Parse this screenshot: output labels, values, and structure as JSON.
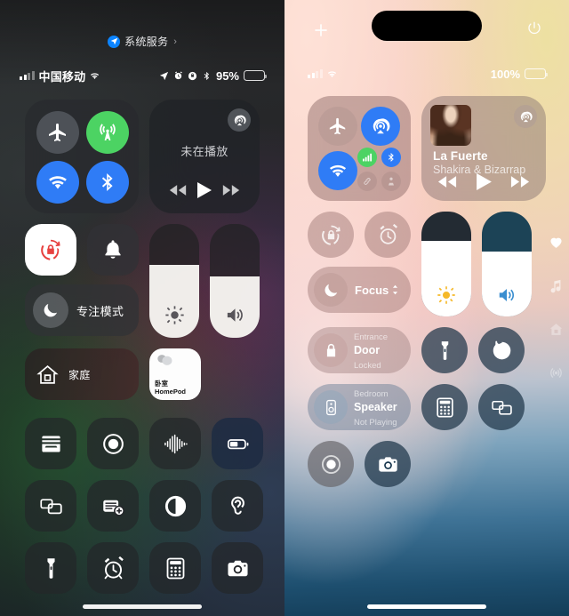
{
  "left_panel": {
    "system_services": {
      "label": "系统服务",
      "chevron": "›",
      "icon": "location-arrow-icon"
    },
    "status_bar": {
      "carrier": "中国移动",
      "signal_icon": "cellular-bars-icon",
      "wifi_icon": "wifi-icon",
      "location_icon": "location-arrow-icon",
      "alarm_icon": "alarm-clock-icon",
      "orientation_lock_icon": "rotation-lock-icon",
      "bluetooth_icon": "bluetooth-icon",
      "battery_percent": "95%",
      "battery_fill": 95
    },
    "connectivity": {
      "airplane": {
        "name": "airplane-mode",
        "state": "off"
      },
      "cellular": {
        "name": "cellular-data",
        "state": "on"
      },
      "wifi": {
        "name": "wifi",
        "state": "on"
      },
      "bluetooth": {
        "name": "bluetooth",
        "state": "on"
      }
    },
    "media": {
      "now_playing": "未在播放",
      "airplay_icon": "airplay-audio-icon",
      "prev": "rewind-icon",
      "play": "play-icon",
      "next": "fast-forward-icon"
    },
    "rotation_lock": {
      "name": "rotation-lock",
      "state": "on"
    },
    "silent_mode": {
      "name": "ring-bell",
      "state": "off"
    },
    "focus": {
      "label": "专注模式",
      "icon": "moon-icon"
    },
    "brightness": {
      "icon": "brightness-icon",
      "value": 64
    },
    "volume": {
      "icon": "volume-icon",
      "value": 54
    },
    "home": {
      "label": "家庭",
      "icon": "home-icon"
    },
    "accessory": {
      "room": "卧室",
      "device": "HomePod",
      "icon": "homepod-icon"
    },
    "grid": [
      {
        "label": "Wallet",
        "icon": "wallet-icon"
      },
      {
        "label": "Screen Recording",
        "icon": "screen-record-icon"
      },
      {
        "label": "Shazam",
        "icon": "soundwave-icon"
      },
      {
        "label": "Low Power Mode",
        "icon": "low-power-battery-icon"
      },
      {
        "label": "Screen Mirroring",
        "icon": "screen-mirroring-icon"
      },
      {
        "label": "Quick Note",
        "icon": "quick-note-icon"
      },
      {
        "label": "Dark Mode",
        "icon": "dark-mode-icon"
      },
      {
        "label": "Hearing",
        "icon": "ear-icon"
      },
      {
        "label": "Flashlight",
        "icon": "flashlight-icon"
      },
      {
        "label": "Alarm",
        "icon": "alarm-clock-icon"
      },
      {
        "label": "Calculator",
        "icon": "calculator-icon"
      },
      {
        "label": "Camera",
        "icon": "camera-icon"
      }
    ]
  },
  "right_panel": {
    "add_control_icon": "plus-icon",
    "power_icon": "power-off-icon",
    "status_bar": {
      "signal_icon": "cellular-bars-icon",
      "wifi_icon": "wifi-icon",
      "battery_percent": "100%",
      "battery_fill": 100
    },
    "connectivity": {
      "airplane": {
        "name": "airplane-mode",
        "state": "off"
      },
      "airdrop": {
        "name": "airdrop",
        "state": "on"
      },
      "wifi": {
        "name": "wifi",
        "state": "on"
      },
      "cellular": {
        "name": "cellular-data",
        "state": "on"
      },
      "bluetooth": {
        "name": "bluetooth",
        "state": "on"
      },
      "vpn": {
        "name": "vpn",
        "state": "off"
      },
      "personal_hotspot": {
        "name": "personal-hotspot",
        "state": "off"
      }
    },
    "media": {
      "track_title": "La Fuerte",
      "track_artist": "Shakira & Bizarrap",
      "airplay_icon": "airplay-audio-icon",
      "prev": "rewind-icon",
      "play": "play-icon",
      "next": "fast-forward-icon",
      "artwork": "album-artwork"
    },
    "rotation_lock": {
      "name": "rotation-lock",
      "state": "off"
    },
    "timer": {
      "name": "alarm-clock",
      "state": "off"
    },
    "focus": {
      "label": "Focus",
      "chevron": "⌃⌄",
      "icon": "moon-icon"
    },
    "brightness": {
      "icon": "brightness-icon",
      "value": 72
    },
    "volume": {
      "icon": "volume-icon",
      "value": 62
    },
    "door": {
      "room": "Entrance",
      "device": "Door",
      "status": "Locked",
      "icon": "lock-icon"
    },
    "speaker": {
      "room": "Bedroom",
      "device": "Speaker",
      "status": "Not Playing",
      "icon": "speaker-icon"
    },
    "flashlight": {
      "label": "Flashlight",
      "icon": "flashlight-icon"
    },
    "timer_btn": {
      "label": "Timer",
      "icon": "timer-icon"
    },
    "calculator": {
      "label": "Calculator",
      "icon": "calculator-icon"
    },
    "screen_mirroring": {
      "label": "Screen Mirroring",
      "icon": "screen-mirroring-icon"
    },
    "screen_record": {
      "label": "Screen Recording",
      "icon": "screen-record-icon"
    },
    "camera": {
      "label": "Camera",
      "icon": "camera-icon"
    },
    "page_icons": [
      {
        "name": "favorites",
        "icon": "heart-icon"
      },
      {
        "name": "music",
        "icon": "music-note-icon"
      },
      {
        "name": "home",
        "icon": "home-icon"
      },
      {
        "name": "connectivity",
        "icon": "broadcast-icon"
      }
    ]
  },
  "colors": {
    "accent_blue": "#2f7cf6",
    "accent_green": "#4cd363",
    "rotation_red": "#e7413f",
    "sun_yellow": "#f5b92a",
    "volume_blue": "#3a8ed0"
  }
}
